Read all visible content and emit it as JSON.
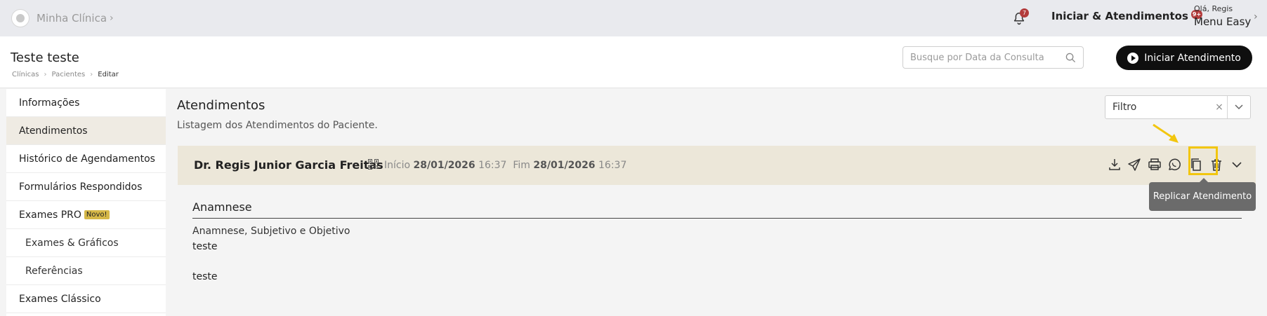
{
  "topbar": {
    "brand_name": "Minha Clínica",
    "notifications_badge": "7",
    "start_link_label": "Iniciar & Atendimentos",
    "start_link_badge": "9+",
    "user_greeting": "Olá, Regis",
    "user_menu_label": "Menu Easy"
  },
  "header": {
    "page_title": "Teste teste",
    "breadcrumb": [
      "Clínicas",
      "Pacientes",
      "Editar"
    ],
    "search_placeholder": "Busque por Data da Consulta",
    "start_button_label": "Iniciar Atendimento"
  },
  "sidebar": {
    "items": [
      {
        "label": "Informações"
      },
      {
        "label": "Atendimentos"
      },
      {
        "label": "Histórico de Agendamentos"
      },
      {
        "label": "Formulários Respondidos"
      },
      {
        "label": "Exames PRO",
        "tag": "Novo!"
      },
      {
        "label": "Exames & Gráficos"
      },
      {
        "label": "Referências"
      },
      {
        "label": "Exames Clássico"
      }
    ]
  },
  "main": {
    "title": "Atendimentos",
    "subtitle": "Listagem dos Atendimentos do Paciente.",
    "filter_label": "Filtro",
    "attendance": {
      "doctor": "Dr. Regis Junior Garcia Freitas",
      "start_label": "Início",
      "start_date": "28/01/2026",
      "start_time": "16:37",
      "end_label": "Fim",
      "end_date": "28/01/2026",
      "end_time": "16:37",
      "tooltip": "Replicar Atendimento",
      "section_title": "Anamnese",
      "field_label": "Anamnese, Subjetivo e Objetivo",
      "field_value_1": "teste",
      "field_value_2": "teste"
    }
  },
  "colors": {
    "card_header_bg": "#ece7d9",
    "active_sidebar_bg": "#efebe3",
    "highlight": "#f2c60f",
    "badge": "#b23b3b"
  },
  "icons": [
    "bell-icon",
    "search-icon",
    "play-icon",
    "qr-code-icon",
    "download-icon",
    "send-icon",
    "print-icon",
    "whatsapp-icon",
    "copy-icon",
    "trash-icon",
    "chevron-down-icon"
  ]
}
